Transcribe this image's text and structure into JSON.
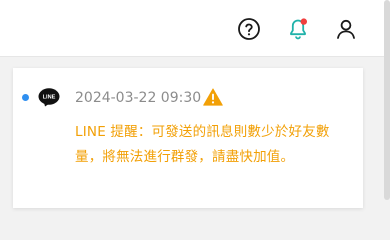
{
  "header": {
    "icons": {
      "help": "question-circle-icon",
      "notifications": "bell-icon",
      "user": "user-icon"
    },
    "notification_badge_color": "#f03e3e",
    "bell_color": "#20b2aa"
  },
  "notification": {
    "source_logo_text": "LINE",
    "source_icon": "line-logo-icon",
    "timestamp": "2024-03-22 09:30",
    "status_icon": "warning-icon",
    "message": "LINE 提醒：可發送的訊息則數少於好友數量，將無法進行群發，請盡快加值。",
    "unread": true
  },
  "colors": {
    "accent_warning": "#f2a007",
    "unread_dot": "#2f8ff0",
    "timestamp": "#8c8c8c"
  }
}
